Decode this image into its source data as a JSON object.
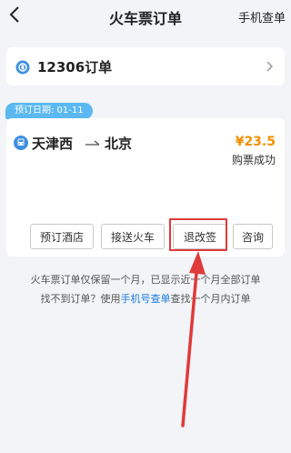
{
  "header": {
    "title": "火车票订单",
    "right_link": "手机查单"
  },
  "order_entry": {
    "label": "12306订单"
  },
  "order": {
    "date_tag": "预订日期: 01-11",
    "from": "天津西",
    "to": "北京",
    "price": "¥23.5",
    "status": "购票成功",
    "actions": {
      "book_hotel": "预订酒店",
      "pickup": "接送火车",
      "refund_change": "退改签",
      "consult": "咨询"
    }
  },
  "notice": {
    "line1": "火车票订单仅保留一个月，已显示近一个月全部订单",
    "line2_prefix": "找不到订单？使用",
    "line2_link": "手机号查单",
    "line2_suffix": "查找一个月内订单"
  },
  "colors": {
    "background": "#f2f4f7",
    "price": "#f29100",
    "accent_blue": "#1e7be0",
    "date_tag": "#5bb8f0",
    "highlight_red": "#e03a3a"
  },
  "icons": {
    "back": "back-arrow-icon",
    "entry": "12306-logo-icon",
    "train": "train-icon",
    "route": "route-arrow-icon",
    "chevron": "chevron-right-icon"
  }
}
